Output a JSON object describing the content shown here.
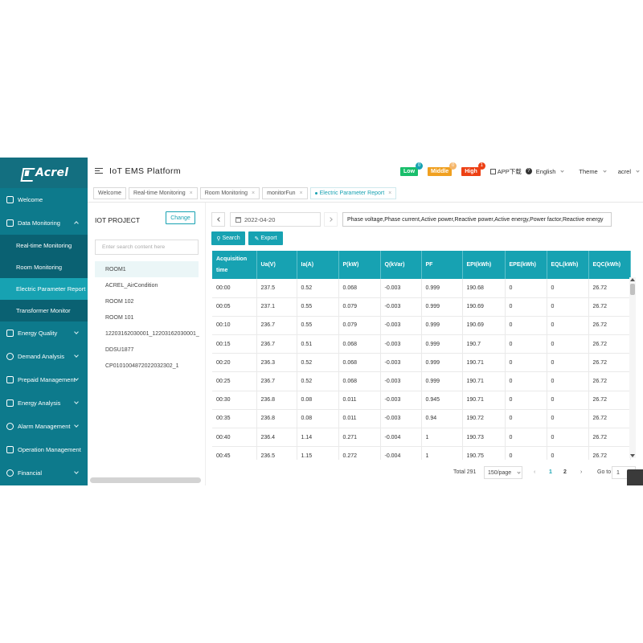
{
  "brand": {
    "logo_text": "Acrel",
    "platform_title": "IoT EMS Platform"
  },
  "sidebar": {
    "items": [
      {
        "label": "Welcome",
        "icon": "monitor-icon"
      },
      {
        "label": "Data Monitoring",
        "icon": "chart-icon",
        "expanded": true,
        "children": [
          {
            "label": "Real-time Monitoring"
          },
          {
            "label": "Room Monitoring"
          },
          {
            "label": "Electric Parameter Report",
            "active": true
          },
          {
            "label": "Transformer Monitor"
          }
        ]
      },
      {
        "label": "Energy Quality",
        "icon": "lightning-icon"
      },
      {
        "label": "Demand Analysis",
        "icon": "analysis-icon"
      },
      {
        "label": "Prepaid Management",
        "icon": "wallet-icon"
      },
      {
        "label": "Energy Analysis",
        "icon": "bar-chart-icon"
      },
      {
        "label": "Alarm Management",
        "icon": "bell-icon"
      },
      {
        "label": "Operation Management",
        "icon": "tools-icon"
      },
      {
        "label": "Financial",
        "icon": "money-icon"
      }
    ]
  },
  "header": {
    "alarm_levels": [
      {
        "label": "Low",
        "count": "0",
        "color": "#19be6b"
      },
      {
        "label": "Middle",
        "count": "0",
        "color": "#f0a020"
      },
      {
        "label": "High",
        "count": "1",
        "color": "#ed4014"
      }
    ],
    "app_download": "APP下载",
    "language": "English",
    "theme": "Theme",
    "user": "acrel"
  },
  "tags": [
    {
      "label": "Welcome",
      "closable": false
    },
    {
      "label": "Real-time Monitoring",
      "closable": true
    },
    {
      "label": "Room Monitoring",
      "closable": true
    },
    {
      "label": "monitorFun",
      "closable": true
    },
    {
      "label": "Electric Parameter Report",
      "closable": true,
      "active": true
    }
  ],
  "left_panel": {
    "title": "IOT PROJECT",
    "change_label": "Change",
    "search_placeholder": "Enter search content here",
    "tree": [
      "ROOM1",
      "ACREL_AirCondition",
      "ROOM 102",
      "ROOM 101",
      "12203162030001_12203162030001_",
      "DDSU1877",
      "CP0101004872022032302_1"
    ]
  },
  "toolbar": {
    "date": "2022-04-20",
    "params": "Phase voltage,Phase current,Active power,Reactive power,Active energy,Power factor,Reactive energy",
    "search_label": "Search",
    "export_label": "Export"
  },
  "table": {
    "columns": [
      "Acquisition time",
      "Ua(V)",
      "Ia(A)",
      "P(kW)",
      "Q(kVar)",
      "PF",
      "EPI(kWh)",
      "EPE(kWh)",
      "EQL(kWh)",
      "EQC(kWh)"
    ],
    "rows": [
      [
        "00:00",
        "237.5",
        "0.52",
        "0.068",
        "-0.003",
        "0.999",
        "190.68",
        "0",
        "0",
        "26.72"
      ],
      [
        "00:05",
        "237.1",
        "0.55",
        "0.079",
        "-0.003",
        "0.999",
        "190.69",
        "0",
        "0",
        "26.72"
      ],
      [
        "00:10",
        "236.7",
        "0.55",
        "0.079",
        "-0.003",
        "0.999",
        "190.69",
        "0",
        "0",
        "26.72"
      ],
      [
        "00:15",
        "236.7",
        "0.51",
        "0.068",
        "-0.003",
        "0.999",
        "190.7",
        "0",
        "0",
        "26.72"
      ],
      [
        "00:20",
        "236.3",
        "0.52",
        "0.068",
        "-0.003",
        "0.999",
        "190.71",
        "0",
        "0",
        "26.72"
      ],
      [
        "00:25",
        "236.7",
        "0.52",
        "0.068",
        "-0.003",
        "0.999",
        "190.71",
        "0",
        "0",
        "26.72"
      ],
      [
        "00:30",
        "236.8",
        "0.08",
        "0.011",
        "-0.003",
        "0.945",
        "190.71",
        "0",
        "0",
        "26.72"
      ],
      [
        "00:35",
        "236.8",
        "0.08",
        "0.011",
        "-0.003",
        "0.94",
        "190.72",
        "0",
        "0",
        "26.72"
      ],
      [
        "00:40",
        "236.4",
        "1.14",
        "0.271",
        "-0.004",
        "1",
        "190.73",
        "0",
        "0",
        "26.72"
      ],
      [
        "00:45",
        "236.5",
        "1.15",
        "0.272",
        "-0.004",
        "1",
        "190.75",
        "0",
        "0",
        "26.72"
      ]
    ]
  },
  "pagination": {
    "total": "Total 291",
    "page_size": "150/page",
    "pages": [
      "1",
      "2"
    ],
    "current": "1",
    "goto_label": "Go to",
    "goto_value": "1"
  }
}
